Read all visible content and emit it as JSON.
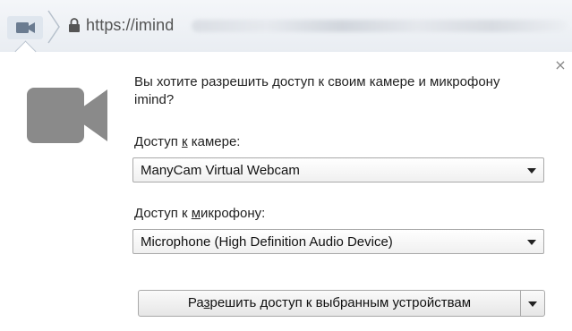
{
  "address_bar": {
    "url": "https://imind",
    "icons": {
      "camera": "camera-icon",
      "lock": "lock-icon"
    }
  },
  "infobar": {
    "question": "Вы хотите разрешить доступ к своим камере и микрофону imind?",
    "camera_label_pre": "Доступ ",
    "camera_label_key": "к",
    "camera_label_post": " камере:",
    "camera_selected": "ManyCam Virtual Webcam",
    "mic_label_pre": "Доступ к ",
    "mic_label_key": "м",
    "mic_label_post": "икрофону:",
    "mic_selected": "Microphone (High Definition Audio Device)",
    "allow_pre": "Ра",
    "allow_key": "з",
    "allow_post": "решить доступ к выбранным устройствам",
    "close_symbol": "×",
    "colors": {
      "camera_icon": "#8a8a8a",
      "border": "#a9a9a9"
    }
  }
}
